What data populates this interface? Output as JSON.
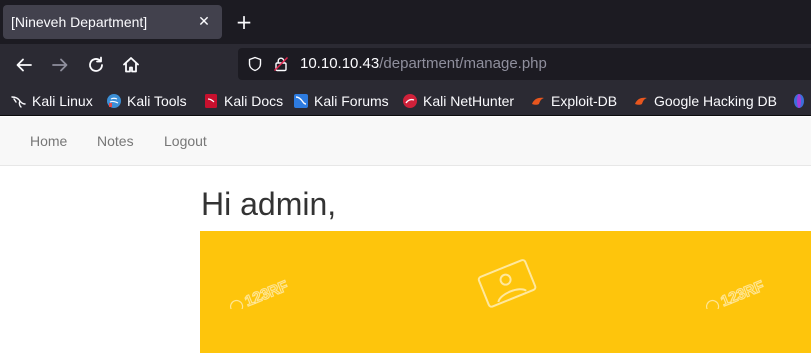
{
  "browser": {
    "tab": {
      "title": "[Nineveh Department]",
      "close": "✕"
    },
    "new_tab": "+",
    "url": {
      "host": "10.10.10.43",
      "path": "/department/manage.php"
    },
    "bookmarks": [
      {
        "label": "Kali Linux",
        "icon": "kali-dragon-icon"
      },
      {
        "label": "Kali Tools",
        "icon": "kali-tools-icon"
      },
      {
        "label": "Kali Docs",
        "icon": "kali-docs-icon"
      },
      {
        "label": "Kali Forums",
        "icon": "kali-forums-icon"
      },
      {
        "label": "Kali NetHunter",
        "icon": "nethunter-icon"
      },
      {
        "label": "Exploit-DB",
        "icon": "exploit-db-icon"
      },
      {
        "label": "Google Hacking DB",
        "icon": "ghdb-icon"
      }
    ]
  },
  "page": {
    "nav": [
      "Home",
      "Notes",
      "Logout"
    ],
    "greeting": "Hi admin,",
    "banner": {
      "color": "#fec50c",
      "watermark": "123RF"
    }
  },
  "colors": {
    "tabstrip": "#1c1b22",
    "toolbar": "#2b2a33",
    "accent": "#fec50c"
  }
}
